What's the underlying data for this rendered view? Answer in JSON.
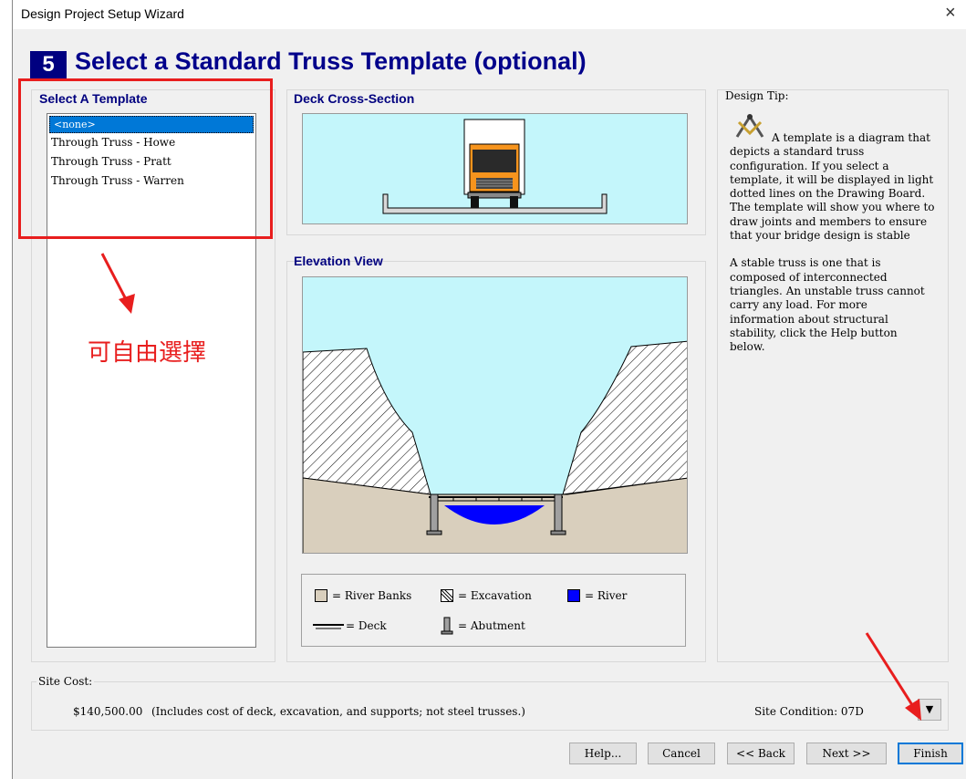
{
  "window": {
    "title": "Design Project Setup Wizard",
    "close_glyph": "×"
  },
  "step": {
    "number": "5",
    "title": "Select a Standard Truss Template (optional)"
  },
  "template_group": {
    "title": "Select A Template",
    "items": [
      "<none>",
      "Through Truss - Howe",
      "Through Truss - Pratt",
      "Through Truss - Warren"
    ],
    "selected_index": 0
  },
  "annotation": {
    "text": "可自由選擇",
    "color": "#e81e1e"
  },
  "deck_section": {
    "title": "Deck Cross-Section"
  },
  "elevation": {
    "title": "Elevation View"
  },
  "legend": {
    "river_banks": "= River Banks",
    "excavation": "= Excavation",
    "river": "= River",
    "deck": "= Deck",
    "abutment": "= Abutment"
  },
  "design_tip": {
    "title": "Design Tip:",
    "paragraph1": "A template is a diagram that depicts a standard truss configuration. If you select a template, it will be displayed in light dotted lines on the Drawing Board. The template will show you where to draw joints and members to ensure that your bridge design is stable",
    "paragraph2": "A stable truss is one that is composed of interconnected triangles. An unstable truss cannot carry any load. For more information about structural stability, click the Help button below.",
    "icon": "compass-square-icon"
  },
  "site_cost": {
    "label": "Site Cost:",
    "amount": "$140,500.00",
    "note": "(Includes cost of deck, excavation, and supports; not steel trusses.)",
    "condition": "Site Condition: 07D",
    "dropdown_glyph": "▼"
  },
  "buttons": {
    "help": "Help...",
    "cancel": "Cancel",
    "back": "<< Back",
    "next": "Next >>",
    "finish": "Finish"
  },
  "colors": {
    "title_blue": "#00008b",
    "sky": "#c4f6fb",
    "bank": "#d9cfbd",
    "river": "#0000ff",
    "truck_orange": "#f7941d",
    "highlight": "#0078d7"
  }
}
